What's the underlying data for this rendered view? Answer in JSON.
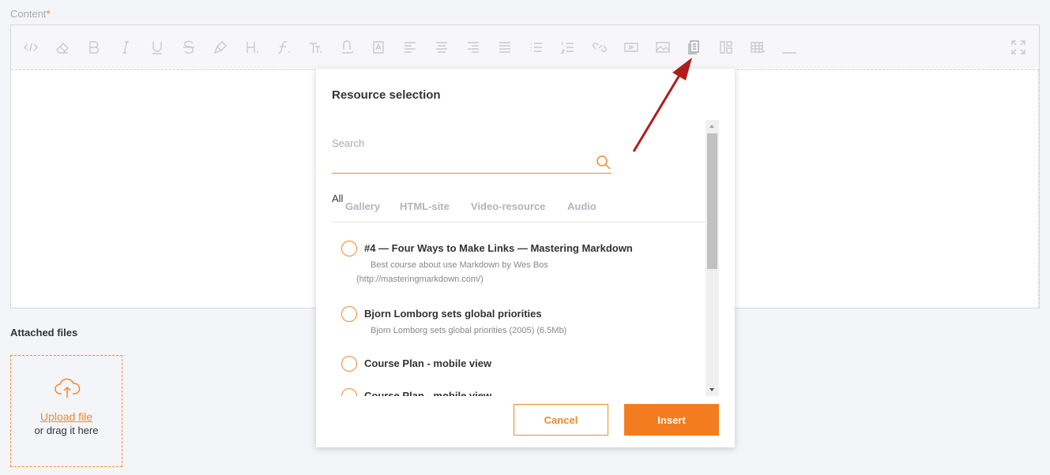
{
  "content_label": "Content",
  "required_mark": "*",
  "toolbar": {
    "icons": [
      "code-view-icon",
      "eraser-icon",
      "bold-icon",
      "italic-icon",
      "underline-icon",
      "strikethrough-icon",
      "paint-brush-icon",
      "heading-icon",
      "font-family-icon",
      "font-size-icon",
      "text-color-icon",
      "background-color-icon",
      "align-left-icon",
      "align-center-icon",
      "align-right-icon",
      "justify-icon",
      "bullet-list-icon",
      "numbered-list-icon",
      "link-icon",
      "video-icon",
      "image-icon",
      "resource-icon",
      "template-icon",
      "table-icon",
      "horizontal-rule-icon"
    ],
    "fullscreen_icon": "fullscreen-icon"
  },
  "attached_files": {
    "title": "Attached files",
    "upload_link": "Upload file",
    "drag_hint": "or drag it here"
  },
  "modal": {
    "title": "Resource selection",
    "search": {
      "label": "Search",
      "value": ""
    },
    "tabs": [
      "All",
      "Gallery",
      "HTML-site",
      "Video-resource",
      "Audio"
    ],
    "items": [
      {
        "title": "#4 — Four Ways to Make Links — Mastering Markdown",
        "desc": "Best course about use Markdown by Wes Bos",
        "desc2": "(http://masteringmarkdown.com/)"
      },
      {
        "title": "Bjorn Lomborg sets global priorities",
        "desc": "Bjorn Lomborg sets global priorities (2005) (6.5Mb)",
        "desc2": ""
      },
      {
        "title": "Course Plan - mobile view",
        "desc": "",
        "desc2": ""
      },
      {
        "title": "Course Plan - mobile view",
        "desc": "",
        "desc2": ""
      }
    ],
    "cancel_label": "Cancel",
    "insert_label": "Insert"
  },
  "colors": {
    "accent": "#f08a2c",
    "insert_bg": "#f47c20",
    "arrow": "#b01c1c"
  }
}
